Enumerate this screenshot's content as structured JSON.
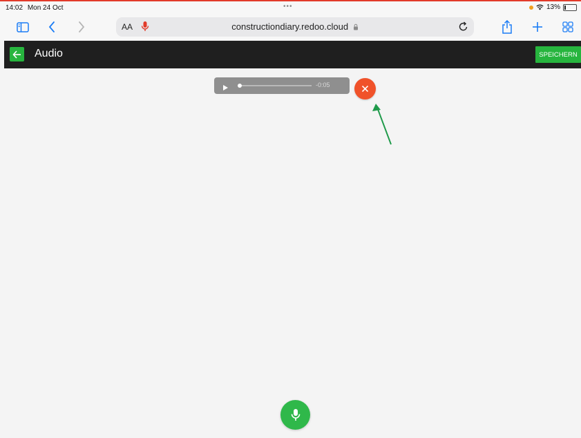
{
  "status": {
    "time": "14:02",
    "date": "Mon 24 Oct",
    "dots": "•••",
    "battery": "13%"
  },
  "browser": {
    "aa_label": "AA",
    "url": "constructiondiary.redoo.cloud",
    "icons": [
      "sidebar-icon",
      "back-icon",
      "forward-icon",
      "microphone-icon",
      "lock-icon",
      "reload-icon",
      "share-icon",
      "plus-icon",
      "tabs-icon"
    ]
  },
  "app": {
    "title": "Audio",
    "save_label": "SPEICHERN"
  },
  "player": {
    "time": "-0:05",
    "progress": 0.0
  },
  "colors": {
    "accent_green": "#27b53e",
    "close_orange": "#f0522a",
    "app_bar": "#1f1f1f",
    "annotation_arrow": "#1f9a4a"
  }
}
